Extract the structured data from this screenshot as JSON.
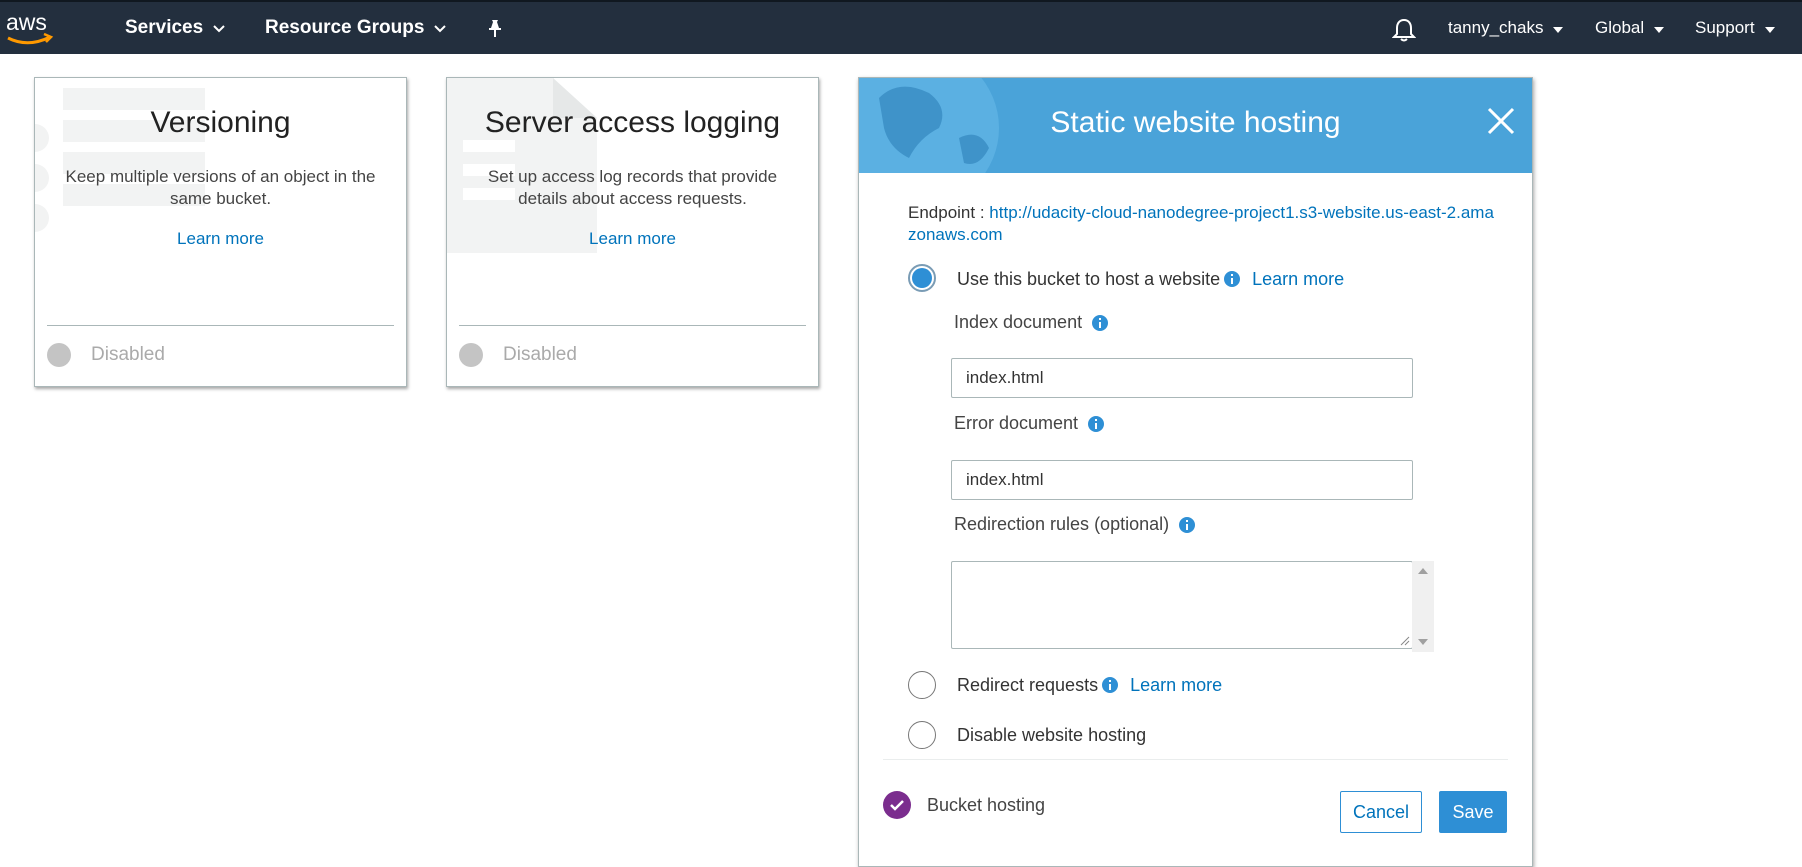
{
  "nav": {
    "logo_text": "aws",
    "services": "Services",
    "resource_groups": "Resource Groups",
    "user": "tanny_chaks",
    "region": "Global",
    "support": "Support"
  },
  "cards": [
    {
      "title": "Versioning",
      "description": "Keep multiple versions of an object in the same bucket.",
      "learn_more": "Learn more",
      "status": "Disabled"
    },
    {
      "title": "Server access logging",
      "description": "Set up access log records that provide details about access requests.",
      "learn_more": "Learn more",
      "status": "Disabled"
    }
  ],
  "hosting_panel": {
    "title": "Static website hosting",
    "endpoint_label": "Endpoint :",
    "endpoint_url": "http://udacity-cloud-nanodegree-project1.s3-website.us-east-2.amazonaws.com",
    "options": [
      {
        "label": "Use this bucket to host a website",
        "learn_more": "Learn more",
        "selected": true
      },
      {
        "label": "Redirect requests",
        "learn_more": "Learn more",
        "selected": false
      },
      {
        "label": "Disable website hosting",
        "selected": false
      }
    ],
    "index_document_label": "Index document",
    "index_document_value": "index.html",
    "error_document_label": "Error document",
    "error_document_value": "index.html",
    "redirection_rules_label": "Redirection rules (optional)",
    "redirection_rules_value": "",
    "bucket_hosting_label": "Bucket hosting",
    "cancel_label": "Cancel",
    "save_label": "Save"
  },
  "colors": {
    "nav_bg": "#232f3e",
    "header_blue": "#4aa3d9",
    "link_blue": "#0073bb",
    "button_blue": "#2e8fd5",
    "check_purple": "#7b2d8e",
    "aws_orange": "#ff9900"
  },
  "icons": [
    "chevron-down-icon",
    "pin-icon",
    "bell-icon",
    "close-icon",
    "info-icon",
    "check-icon"
  ]
}
